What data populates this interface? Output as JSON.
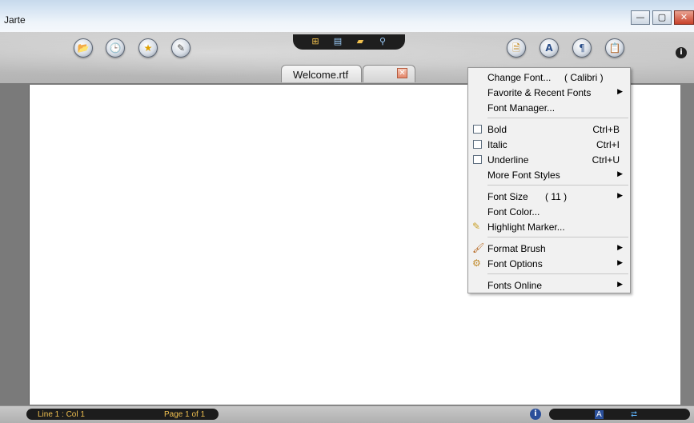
{
  "window": {
    "title": "Jarte",
    "minimize_glyph": "—",
    "maximize_glyph": "▢",
    "close_glyph": "✕"
  },
  "toolbar": {
    "left_buttons": [
      {
        "name": "open-icon",
        "glyph": "📂"
      },
      {
        "name": "recent-icon",
        "glyph": "🕒"
      },
      {
        "name": "favorites-icon",
        "glyph": "★"
      },
      {
        "name": "edit-icon",
        "glyph": "✎"
      }
    ],
    "tray_icons": [
      "⊞",
      "▤",
      "▰",
      "⚲"
    ],
    "right_buttons": [
      {
        "name": "page-icon",
        "glyph": "🗎"
      },
      {
        "name": "font-icon",
        "glyph": "A"
      },
      {
        "name": "paragraph-icon",
        "glyph": "¶"
      },
      {
        "name": "clipboard-icon",
        "glyph": "📋"
      }
    ],
    "info_glyph": "i"
  },
  "tabs": [
    {
      "label": "Welcome.rtf"
    }
  ],
  "tab_close_glyph": "✕",
  "status": {
    "position": "Line 1 : Col 1",
    "page": "Page 1 of 1",
    "info_glyph": "i",
    "mode_glyph": "A",
    "wrap_glyph": "⮂"
  },
  "menu": {
    "items": [
      {
        "label": "Change Font...",
        "extra": "( Calibri )",
        "submenu": false
      },
      {
        "label": "Favorite & Recent Fonts",
        "submenu": true
      },
      {
        "label": "Font Manager...",
        "submenu": false
      },
      {
        "label": "Bold",
        "shortcut": "Ctrl+B",
        "checked": false
      },
      {
        "label": "Italic",
        "shortcut": "Ctrl+I",
        "checked": false
      },
      {
        "label": "Underline",
        "shortcut": "Ctrl+U",
        "checked": false
      },
      {
        "label": "More Font Styles",
        "submenu": true
      },
      {
        "label": "Font Size",
        "extra": "( 11 )",
        "submenu": true
      },
      {
        "label": "Font Color...",
        "submenu": false
      },
      {
        "label": "Highlight Marker...",
        "submenu": false,
        "icon": "highlighter-icon"
      },
      {
        "label": "Format Brush",
        "submenu": true,
        "icon": "brush-icon"
      },
      {
        "label": "Font Options",
        "submenu": true,
        "icon": "gear-icon"
      },
      {
        "label": "Fonts Online",
        "submenu": true
      }
    ],
    "arrow_glyph": "▶"
  },
  "colors": {
    "accent_status_text": "#f0c050",
    "menu_background": "#f1f1f1"
  }
}
